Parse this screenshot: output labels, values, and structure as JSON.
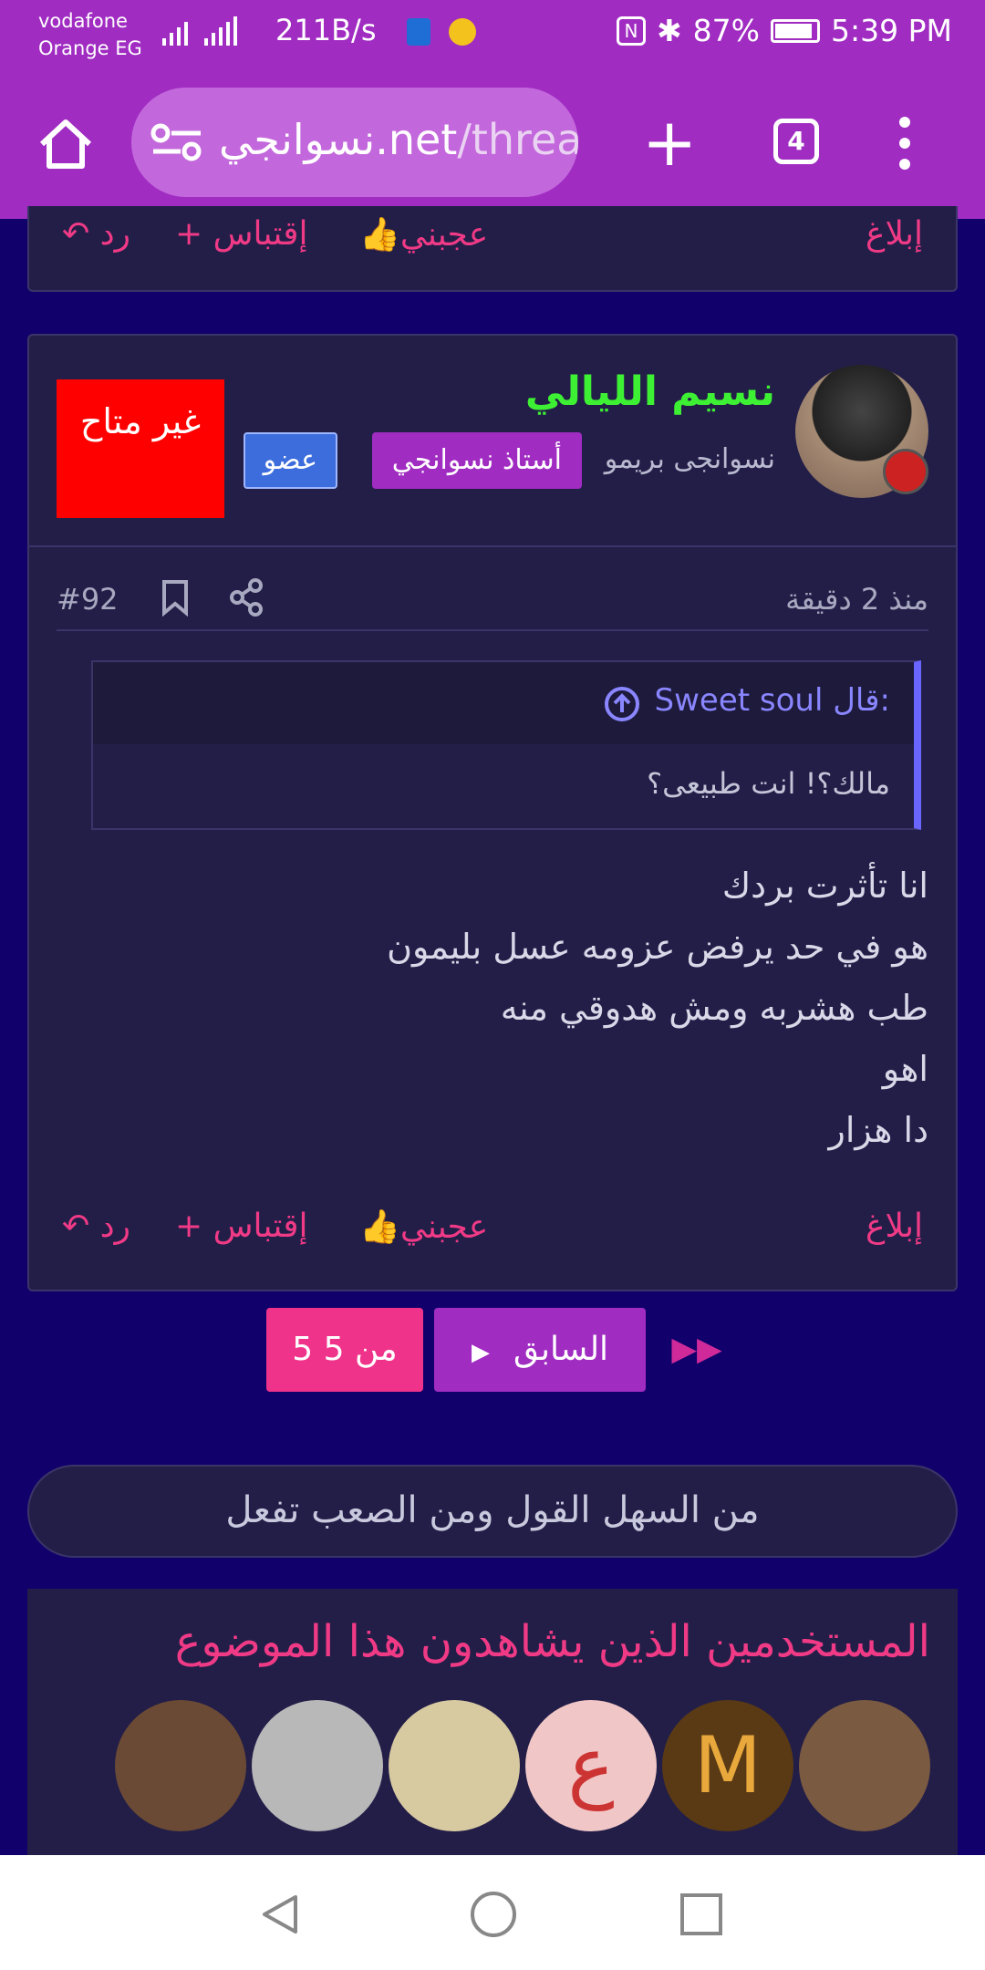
{
  "status": {
    "carrier_line1": "vodafone",
    "carrier_line2": "Orange EG",
    "speed": "211B/s",
    "battery": "87%",
    "time": "5:39 PM"
  },
  "browser": {
    "url_main": "نسوانجي.net",
    "url_dim": "/threa",
    "tab_count": "4"
  },
  "prev_post_actions": {
    "report": "إبلاغ",
    "like": "عجبني",
    "quote": "إقتباس",
    "reply": "رد"
  },
  "post": {
    "username": "نسيم الليالي",
    "rank": "نسوانجى بريمو",
    "tag1": "أستاذ نسوانجي",
    "tag2": "عضو",
    "unavailable": "غير متاح",
    "time": "منذ 2 دقيقة",
    "number": "#92",
    "quote_author": "Sweet soul قال:",
    "quote_text": "مالك؟! انت طبيعى؟",
    "body_lines": [
      "انا تأثرت بردك",
      "هو في حد يرفض عزومه عسل بليمون",
      "طب هشربه ومش هدوقي منه",
      "اهو",
      "دا هزار"
    ],
    "actions": {
      "report": "إبلاغ",
      "like": "عجبني",
      "quote": "إقتباس",
      "reply": "رد"
    }
  },
  "pager": {
    "page_info": "5 من 5",
    "prev_label": "السابق"
  },
  "motto": "من السهل القول ومن الصعب تفعل",
  "viewers": {
    "title": "المستخدمين الذين يشاهدون هذا الموضوع",
    "avatars": [
      {
        "letter": "",
        "color": "#6b4a35"
      },
      {
        "letter": "M",
        "color": "#5a3a14"
      },
      {
        "letter": "ع",
        "color": "#f1c6c6"
      },
      {
        "letter": "",
        "color": "#d7c9a0"
      },
      {
        "letter": "",
        "color": "#b8b8b8"
      },
      {
        "letter": "",
        "color": "#7a5a40"
      }
    ]
  },
  "colors": {
    "accent_purple": "#a02cc2",
    "accent_pink": "#f03a86",
    "username_green": "#3ef033",
    "background": "#11006b",
    "card": "#221e48"
  }
}
